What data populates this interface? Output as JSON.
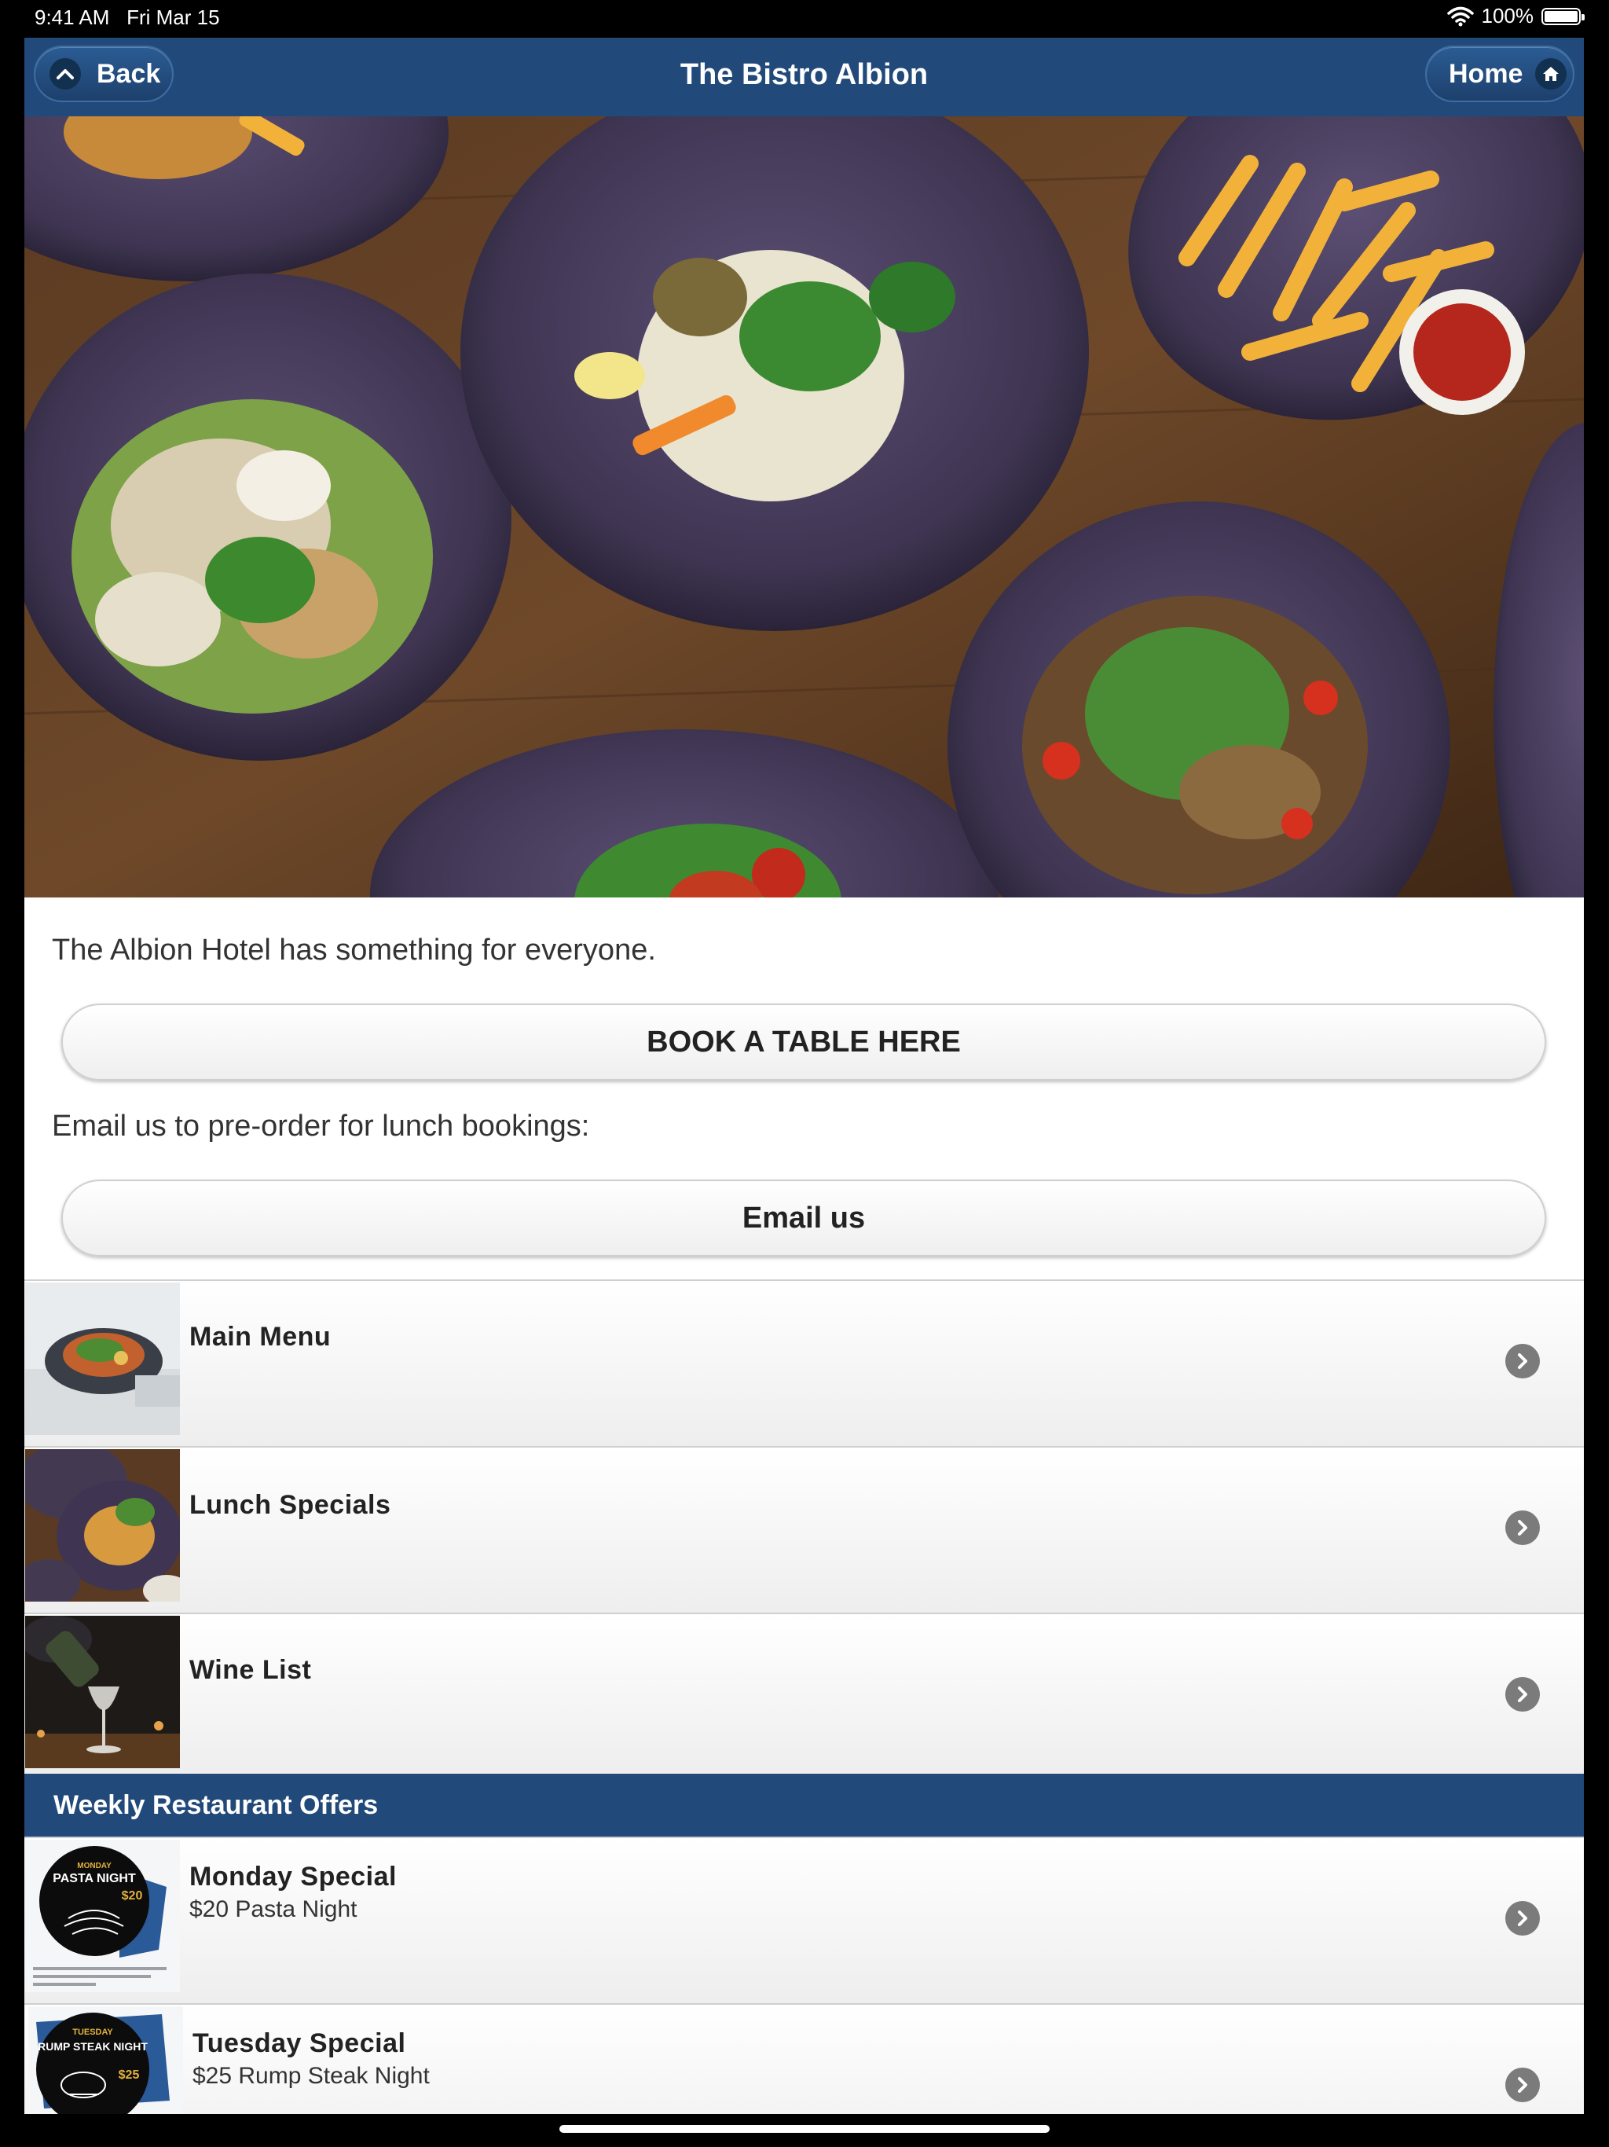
{
  "status_bar": {
    "time": "9:41 AM",
    "date": "Fri Mar 15",
    "battery": "100%"
  },
  "navbar": {
    "title": "The Bistro Albion",
    "back_label": "Back",
    "home_label": "Home"
  },
  "content": {
    "intro": "The Albion Hotel has something for everyone.",
    "book_button": "BOOK A TABLE HERE",
    "email_prompt": "Email us to pre-order for lunch bookings:",
    "email_button": "Email us"
  },
  "menu_list": [
    {
      "title": "Main Menu"
    },
    {
      "title": "Lunch Specials"
    },
    {
      "title": "Wine List"
    }
  ],
  "offers": {
    "header": "Weekly Restaurant Offers",
    "items": [
      {
        "title": "Monday Special",
        "subtitle": "$20 Pasta Night",
        "thumb_line1": "MONDAY",
        "thumb_line2": "PASTA NIGHT",
        "thumb_price": "$20"
      },
      {
        "title": "Tuesday Special",
        "subtitle": "$25 Rump Steak Night",
        "thumb_line1": "TUESDAY",
        "thumb_line2": "RUMP STEAK NIGHT",
        "thumb_price": "$25"
      }
    ]
  },
  "colors": {
    "navbar": "#21497a",
    "header": "#21497a"
  }
}
